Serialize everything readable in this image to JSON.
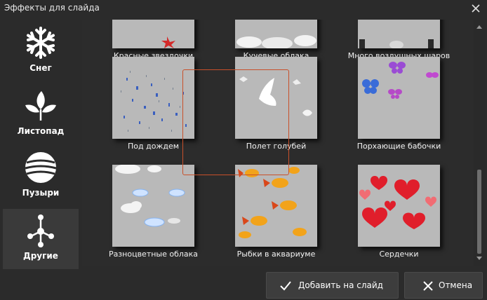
{
  "window": {
    "title": "Эффекты для слайда"
  },
  "sidebar": {
    "items": [
      {
        "label": "Снег",
        "icon": "snowflake-icon",
        "active": false
      },
      {
        "label": "Листопад",
        "icon": "leaves-icon",
        "active": false
      },
      {
        "label": "Пузыри",
        "icon": "bubble-icon",
        "active": false
      },
      {
        "label": "Другие",
        "icon": "network-icon",
        "active": true
      }
    ]
  },
  "effects": {
    "items": [
      {
        "label": "Красные звездочки"
      },
      {
        "label": "Кучевые облака"
      },
      {
        "label": "Много воздушных шаров"
      },
      {
        "label": "Под дождем",
        "selected": true
      },
      {
        "label": "Полет голубей"
      },
      {
        "label": "Порхающие бабочки"
      },
      {
        "label": "Разноцветные облака"
      },
      {
        "label": "Рыбки в аквариуме"
      },
      {
        "label": "Сердечки"
      }
    ]
  },
  "footer": {
    "add_label": "Добавить на слайд",
    "cancel_label": "Отмена"
  },
  "colors": {
    "accent": "#c8502a",
    "panel": "#2c2c2c",
    "background": "#2b2b2b"
  }
}
